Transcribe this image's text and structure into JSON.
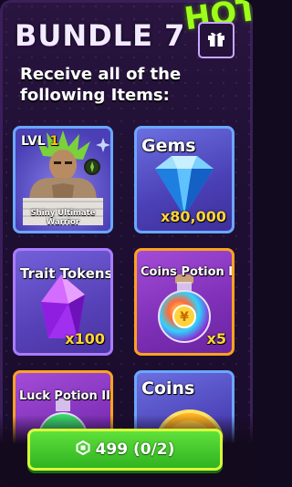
{
  "header": {
    "hot_text": "HOT",
    "title": "BUNDLE 7"
  },
  "subtitle": "Receive all of the following Items:",
  "items": [
    {
      "label_prefix": "LVL",
      "level": "1",
      "name": "Shiny Ultimate Warrior"
    },
    {
      "label": "Gems",
      "quantity": "x80,000"
    },
    {
      "label": "Trait Tokens",
      "quantity": "x100"
    },
    {
      "label": "Coins Potion II",
      "quantity": "x5"
    },
    {
      "label": "Luck Potion II"
    },
    {
      "label": "Coins"
    }
  ],
  "purchase": {
    "price_text": "499 (0/2)"
  },
  "colors": {
    "accent_green": "#3ec92a",
    "gold": "#ffd43a",
    "panel": "#1e0f33"
  }
}
